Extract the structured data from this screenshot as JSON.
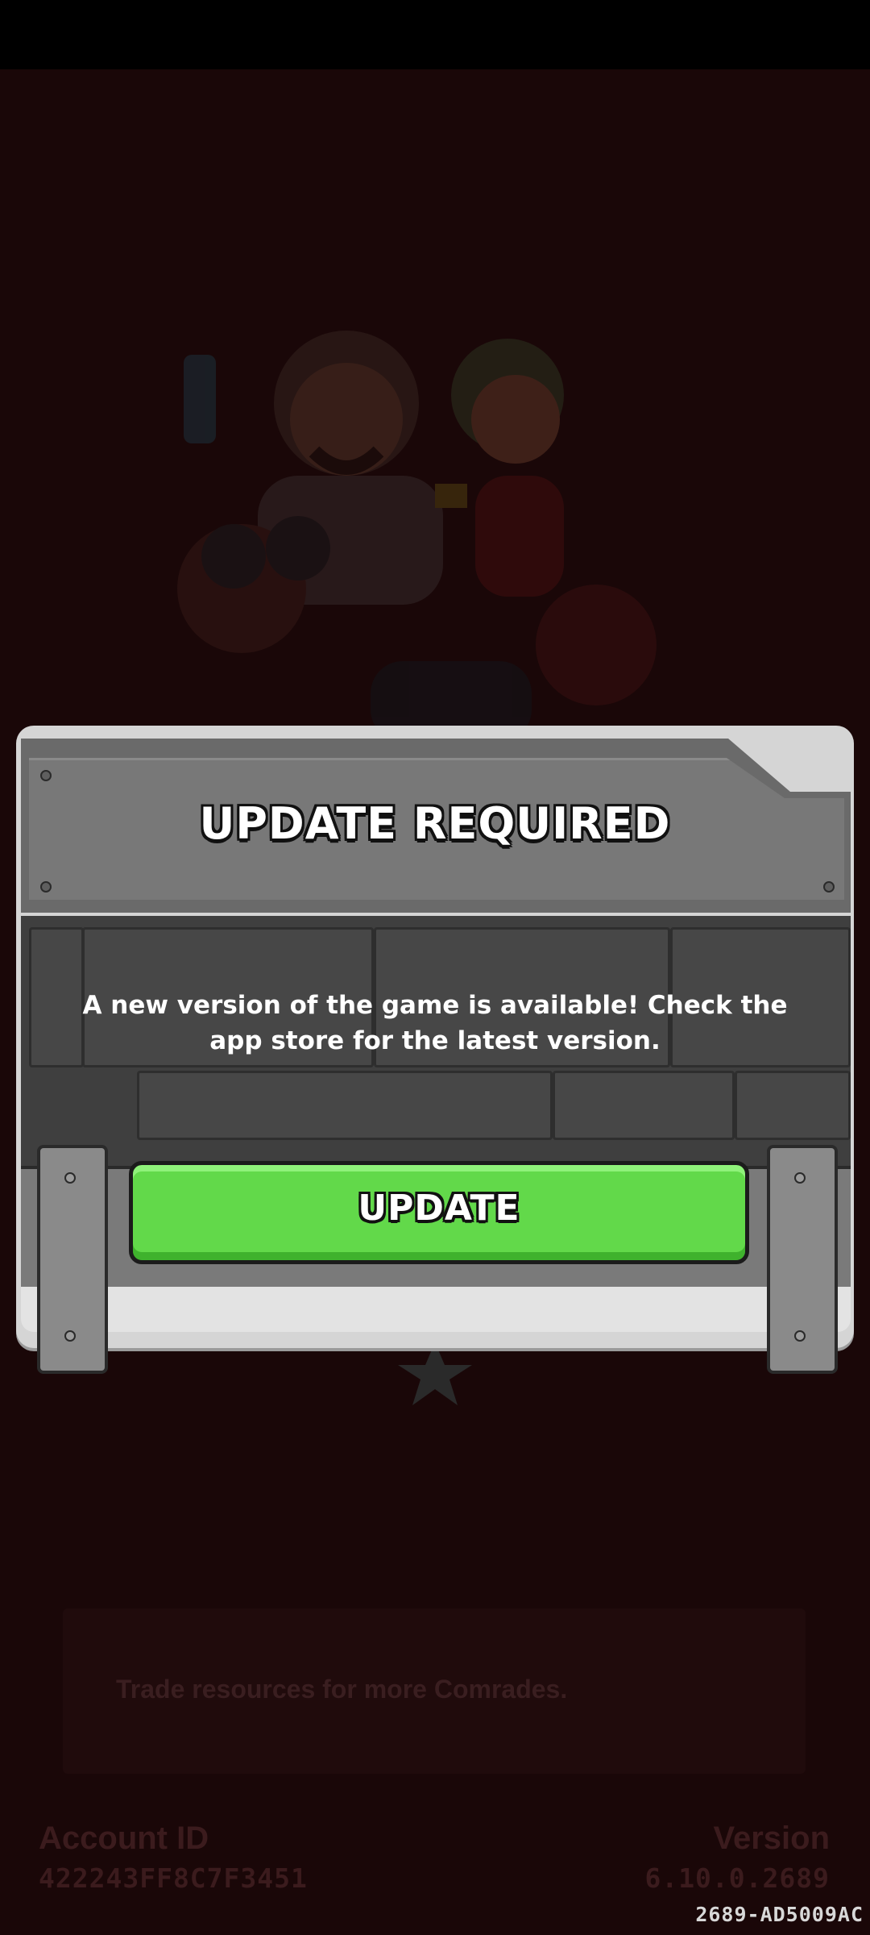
{
  "dialog": {
    "title": "UPDATE REQUIRED",
    "message": "A new version of the game is available! Check the app store for the latest version.",
    "button_label": "UPDATE"
  },
  "background": {
    "trade_text": "Trade resources for more Comrades.",
    "account_label": "Account ID",
    "account_id": "422243FF8C7F3451",
    "version_label": "Version",
    "version_value": "6.10.0.2689",
    "build_id": "2689-AD5009AC"
  },
  "colors": {
    "background": "#1a0708",
    "button_green": "#62d94a",
    "panel_gray": "#3f3f3f"
  },
  "icons": [
    "character-illustration",
    "star-icon"
  ]
}
